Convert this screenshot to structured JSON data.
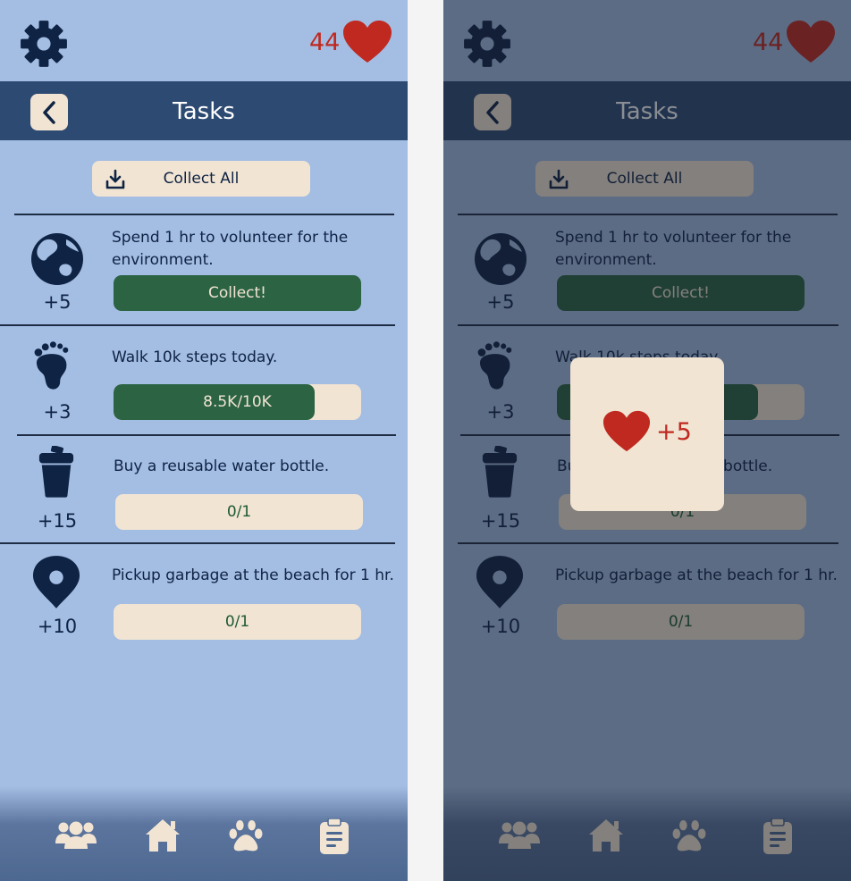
{
  "header": {
    "hearts_count": "44",
    "title": "Tasks"
  },
  "collect_all": {
    "label": "Collect All"
  },
  "tasks": [
    {
      "icon": "globe-icon",
      "points": "+5",
      "description_line1": "Spend 1 hr to volunteer for the",
      "description_line2": "environment.",
      "action": "Collect!",
      "state": "collect"
    },
    {
      "icon": "footprint-icon",
      "points": "+3",
      "description_line1": "Walk 10k steps today.",
      "description_line2": "",
      "action": "8.5K/10K",
      "state": "progress",
      "progress": 0.85
    },
    {
      "icon": "water-bottle-icon",
      "points": "+15",
      "description_line1": "Buy a reusable water bottle.",
      "description_line2": "",
      "action": "0/1",
      "state": "progress",
      "progress": 0
    },
    {
      "icon": "map-pin-icon",
      "points": "+10",
      "description_line1": "Pickup garbage at the beach for 1 hr.",
      "description_line2": "",
      "action": "0/1",
      "state": "progress",
      "progress": 0
    }
  ],
  "nav": {
    "items": [
      "friends-icon",
      "home-icon",
      "paw-icon",
      "clipboard-icon"
    ]
  },
  "popup": {
    "reward": "+5"
  },
  "colors": {
    "background": "#a3bde3",
    "header": "#2d4a72",
    "navy": "#0f2344",
    "cream": "#f1e4d3",
    "green": "#2b6343",
    "heart": "#c0291f"
  }
}
